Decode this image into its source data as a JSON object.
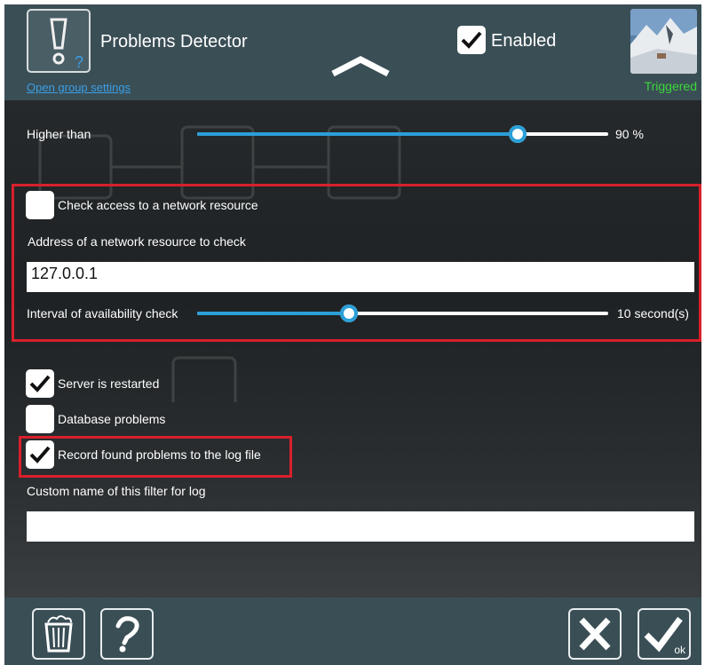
{
  "header": {
    "title": "Problems Detector",
    "group_link": "Open group settings",
    "enabled_label": "Enabled",
    "enabled_checked": true,
    "status": "Triggered",
    "status_color": "#3ad83a"
  },
  "threshold": {
    "label": "Higher than",
    "value_text": "90 %",
    "value_fraction": 0.78
  },
  "network": {
    "check_label": "Check access to a network resource",
    "check_checked": false,
    "address_label": "Address of a network resource to check",
    "address_value": "127.0.0.1",
    "interval_label": "Interval of availability check",
    "interval_text": "10 second(s)",
    "interval_fraction": 0.37
  },
  "options": {
    "restart_label": "Server is restarted",
    "restart_checked": true,
    "database_label": "Database problems",
    "database_checked": false,
    "record_label": "Record found problems to the log file",
    "record_checked": true
  },
  "log": {
    "custom_name_label": "Custom name of this filter for log",
    "custom_name_value": ""
  },
  "footer": {
    "ok_sub": "ok"
  },
  "colors": {
    "accent": "#2a9fd8",
    "highlight": "#d8202c",
    "panel": "#3a4e55"
  },
  "icons": [
    "warning-icon",
    "question-icon",
    "chevron-up-icon",
    "checkmark-icon",
    "trash-icon",
    "help-icon",
    "close-icon",
    "ok-icon"
  ]
}
